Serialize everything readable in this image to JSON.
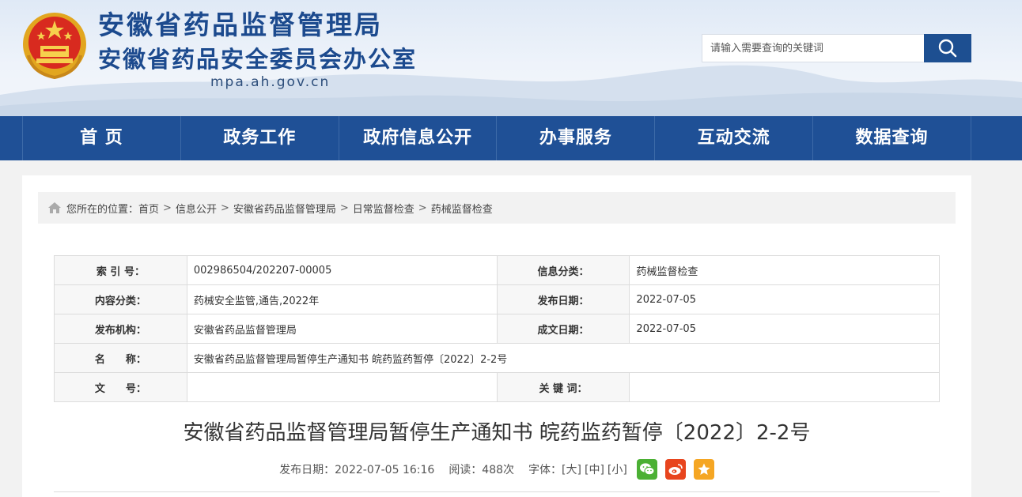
{
  "header": {
    "title": "安徽省药品监督管理局",
    "subtitle": "安徽省药品安全委员会办公室",
    "domain": "mpa.ah.gov.cn",
    "search_placeholder": "请输入需要查询的关键词",
    "search_icon": "search-icon"
  },
  "nav": {
    "items": [
      {
        "label": "首 页"
      },
      {
        "label": "政务工作"
      },
      {
        "label": "政府信息公开"
      },
      {
        "label": "办事服务"
      },
      {
        "label": "互动交流"
      },
      {
        "label": "数据查询"
      }
    ]
  },
  "breadcrumb": {
    "prefix": "您所在的位置：",
    "items": [
      "首页",
      "信息公开",
      "安徽省药品监督管理局",
      "日常监督检查",
      "药械监督检查"
    ],
    "separator": ">"
  },
  "meta": {
    "index_label": "索 引 号：",
    "index_value": "002986504/202207-00005",
    "category_label": "信息分类：",
    "category_value": "药械监督检查",
    "content_label": "内容分类：",
    "content_value": "药械安全监管,通告,2022年",
    "publish_label": "发布日期：",
    "publish_value": "2022-07-05",
    "org_label": "发布机构：",
    "org_value": "安徽省药品监督管理局",
    "created_label": "成文日期：",
    "created_value": "2022-07-05",
    "name_label": "名　　称：",
    "name_value": "安徽省药品监督管理局暂停生产通知书 皖药监药暂停〔2022〕2-2号",
    "docno_label": "文　　号：",
    "docno_value": "",
    "keywords_label": "关 键 词：",
    "keywords_value": ""
  },
  "article": {
    "title": "安徽省药品监督管理局暂停生产通知书 皖药监药暂停〔2022〕2-2号",
    "publish_text": "发布日期：2022-07-05 16:16",
    "views_text": "阅读：488次",
    "fontsize_label": "字体：",
    "fontsize_large": "[大]",
    "fontsize_medium": "[中]",
    "fontsize_small": "[小]"
  },
  "colors": {
    "brand": "#1f5096",
    "title": "#1c4a8e",
    "wechat": "#4bb034",
    "weibo": "#e8451e",
    "favorite": "#f5a623"
  }
}
